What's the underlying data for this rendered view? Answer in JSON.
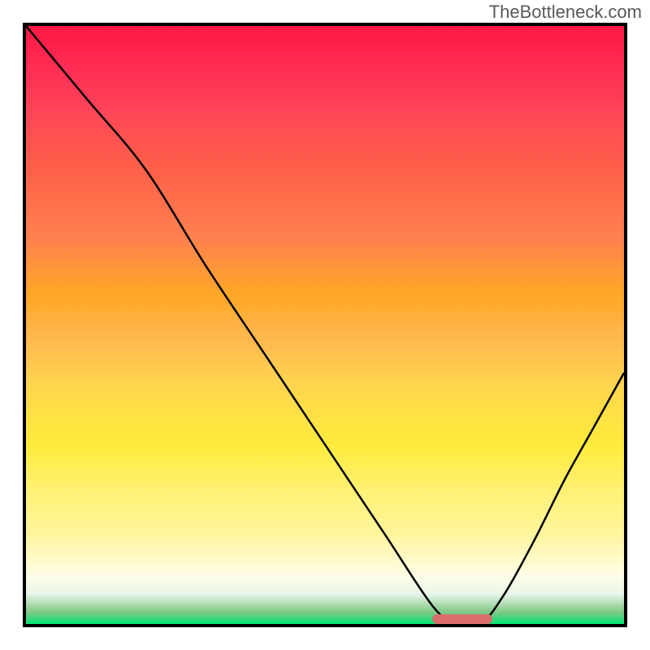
{
  "watermark": "TheBottleneck.com",
  "chart_data": {
    "type": "line",
    "title": "",
    "xlabel": "",
    "ylabel": "",
    "xlim": [
      0,
      100
    ],
    "ylim": [
      0,
      100
    ],
    "series": [
      {
        "name": "bottleneck-curve",
        "x": [
          0,
          10,
          20,
          30,
          40,
          50,
          60,
          68,
          72,
          76,
          80,
          85,
          90,
          95,
          100
        ],
        "values": [
          100,
          88,
          76,
          60,
          45,
          30,
          15,
          3,
          0,
          0,
          5,
          14,
          24,
          33,
          42
        ]
      }
    ],
    "marker": {
      "x_start": 68,
      "x_end": 78,
      "color": "#d96c6c"
    },
    "gradient_stops": [
      {
        "pos": 0,
        "color": "#ff1744"
      },
      {
        "pos": 50,
        "color": "#ffb300"
      },
      {
        "pos": 80,
        "color": "#ffee58"
      },
      {
        "pos": 100,
        "color": "#00e676"
      }
    ]
  }
}
